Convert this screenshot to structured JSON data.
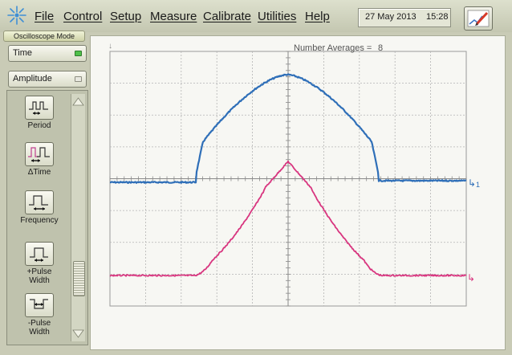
{
  "menu": {
    "items": [
      "File",
      "Control",
      "Setup",
      "Measure",
      "Calibrate",
      "Utilities",
      "Help"
    ],
    "date": "27 May 2013",
    "time": "15:28"
  },
  "left_panel": {
    "mode": "Oscilloscope Mode",
    "x_axis_select": "Time",
    "y_axis_select": "Amplitude",
    "measurements": [
      "Period",
      "ΔTime",
      "Frequency",
      "+Pulse\nWidth",
      "-Pulse\nWidth"
    ]
  },
  "display": {
    "averages_label": "Number Averages =",
    "averages_value": "8",
    "channel1_marker": "1",
    "colors": {
      "channel1": "#2f6fb8",
      "channel2": "#d8357f",
      "grid": "#b4b4b4",
      "background": "#f7f7f3"
    }
  }
}
